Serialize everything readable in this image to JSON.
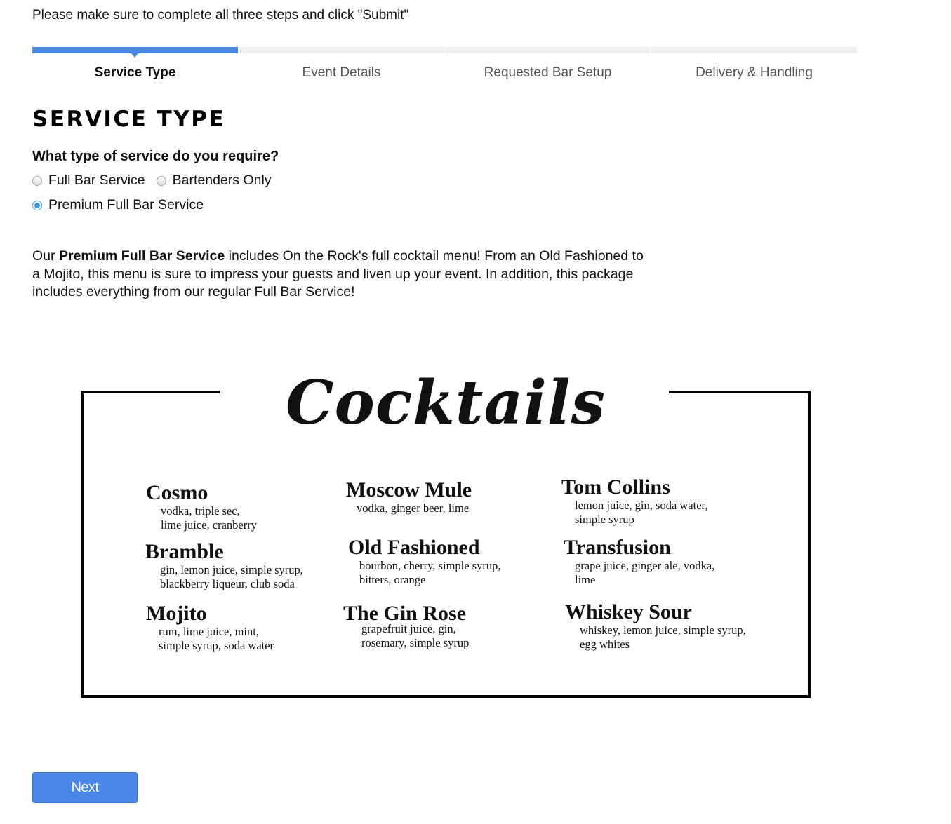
{
  "instructions": "Please make sure to complete all three steps and click \"Submit\"",
  "steps": [
    {
      "label": "Service Type",
      "active": true
    },
    {
      "label": "Event Details",
      "active": false
    },
    {
      "label": "Requested Bar Setup",
      "active": false
    },
    {
      "label": "Delivery & Handling",
      "active": false
    }
  ],
  "section_heading": "SERVICE TYPE",
  "question": "What type of service do you require?",
  "service_options": [
    {
      "label": "Full Bar Service",
      "checked": false
    },
    {
      "label": "Bartenders Only",
      "checked": false
    },
    {
      "label": "Premium Full Bar Service",
      "checked": true
    }
  ],
  "description": {
    "prefix": "Our ",
    "highlight": "Premium Full Bar Service",
    "suffix": " includes On the Rock's full cocktail menu! From an Old Fashioned to a Mojito, this menu is sure to impress your guests and liven up your event. In addition, this package includes everything from our regular Full Bar Service!"
  },
  "menu": {
    "title": "Cocktails",
    "cocktails": [
      {
        "name": "Cosmo",
        "ingredients": "vodka, triple sec,\nlime juice, cranberry"
      },
      {
        "name": "Moscow Mule",
        "ingredients": "vodka, ginger beer, lime"
      },
      {
        "name": "Tom Collins",
        "ingredients": "lemon juice, gin, soda water,\nsimple syrup"
      },
      {
        "name": "Bramble",
        "ingredients": "gin, lemon juice, simple syrup,\nblackberry liqueur, club soda"
      },
      {
        "name": "Old Fashioned",
        "ingredients": "bourbon, cherry, simple syrup,\nbitters, orange"
      },
      {
        "name": "Transfusion",
        "ingredients": "grape juice, ginger ale, vodka,\nlime"
      },
      {
        "name": "Mojito",
        "ingredients": "rum, lime juice, mint,\nsimple syrup, soda water"
      },
      {
        "name": "The Gin Rose",
        "ingredients": "grapefruit juice, gin,\nrosemary, simple syrup"
      },
      {
        "name": "Whiskey Sour",
        "ingredients": "whiskey, lemon juice, simple syrup,\negg whites"
      }
    ]
  },
  "next_button": "Next",
  "colors": {
    "accent": "#4a86e8",
    "inactive_step_bar": "#f0f0f0",
    "radio_checked": "#3d96e8"
  }
}
